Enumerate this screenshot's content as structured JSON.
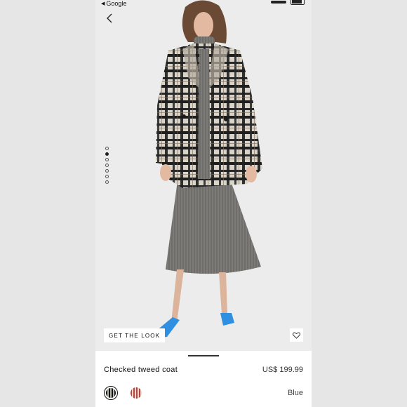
{
  "status_bar": {
    "back_app": "Google"
  },
  "gallery": {
    "page_count": 7,
    "active_index": 1
  },
  "actions": {
    "get_the_look": "GET THE LOOK"
  },
  "product": {
    "name": "Checked tweed coat",
    "price": "US$ 199.99",
    "selected_color": "Blue",
    "swatches": [
      "black-white-check",
      "red-white-check"
    ]
  },
  "colors": {
    "background": "#ececec",
    "sheet": "#ffffff",
    "shoe_accent": "#2f8fe0"
  }
}
